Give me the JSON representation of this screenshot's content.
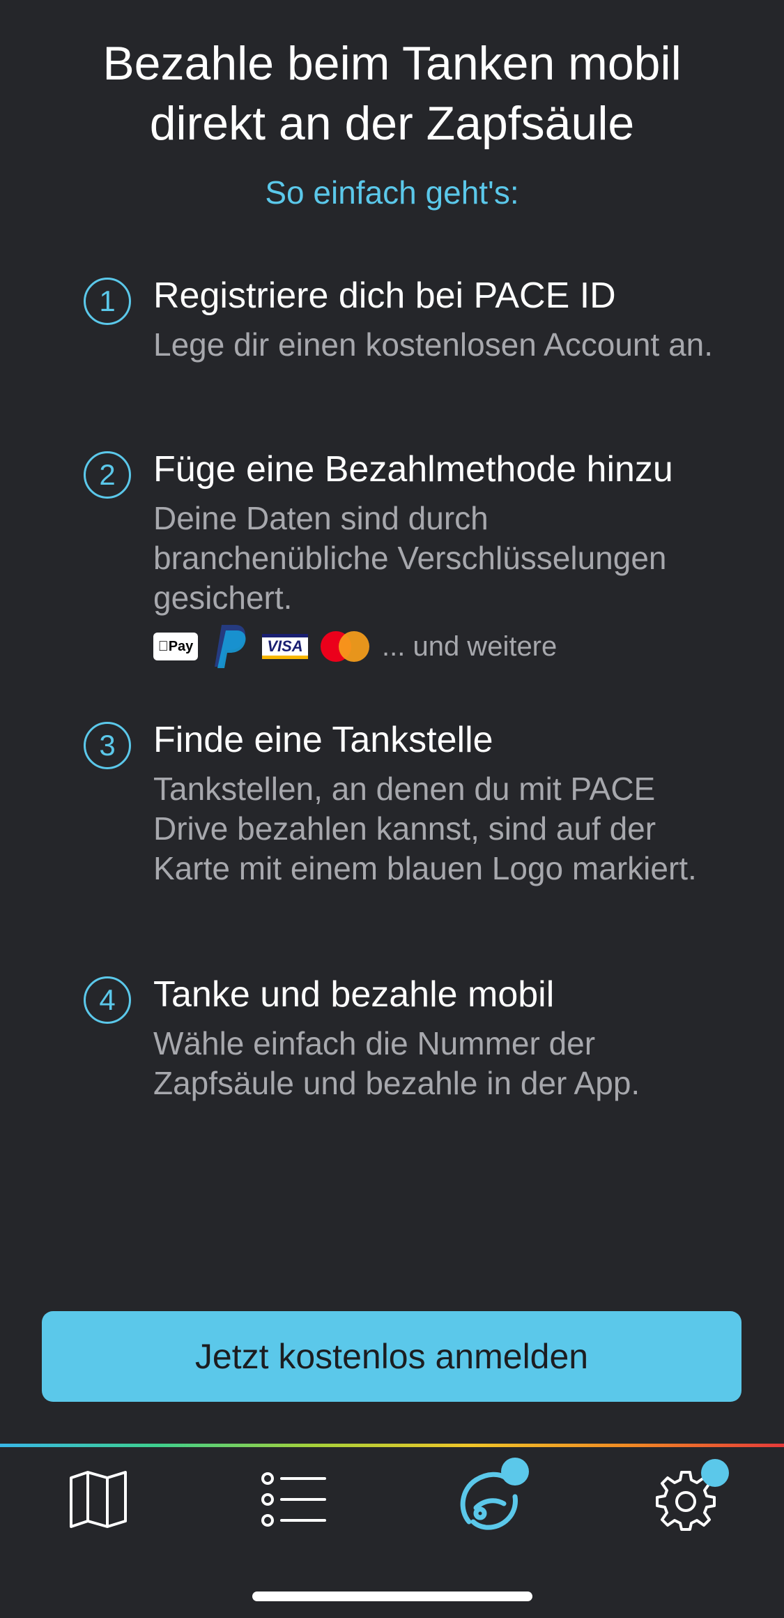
{
  "header": {
    "title_line1": "Bezahle beim Tanken mobil",
    "title_line2": "direkt an der Zapfsäule",
    "subtitle": "So einfach geht's:"
  },
  "steps": [
    {
      "number": "1",
      "title": "Registriere dich bei PACE ID",
      "description": "Lege dir einen kostenlosen Account an."
    },
    {
      "number": "2",
      "title": "Füge eine Bezahlmethode hinzu",
      "description": "Deine Daten sind durch branchenübliche Verschlüsselungen gesichert.",
      "payment_methods": [
        "apple-pay",
        "paypal",
        "visa",
        "mastercard"
      ],
      "apple_pay_label": "Pay",
      "visa_label": "VISA",
      "more_label": "... und weitere"
    },
    {
      "number": "3",
      "title": "Finde eine Tankstelle",
      "description": "Tankstellen, an denen du mit PACE Drive bezahlen kannst, sind auf der Karte mit einem blauen Logo markiert."
    },
    {
      "number": "4",
      "title": "Tanke und bezahle mobil",
      "description": "Wähle einfach die Nummer der Zapfsäule und bezahle in der App."
    }
  ],
  "cta": {
    "label": "Jetzt kostenlos anmelden"
  },
  "tabbar": {
    "items": [
      {
        "icon": "map-icon",
        "active": false,
        "badge": false
      },
      {
        "icon": "list-icon",
        "active": false,
        "badge": false
      },
      {
        "icon": "pace-drive-icon",
        "active": true,
        "badge": true
      },
      {
        "icon": "gear-icon",
        "active": false,
        "badge": true
      }
    ]
  },
  "colors": {
    "background": "#25262a",
    "accent": "#5bc8ea",
    "text_primary": "#ffffff",
    "text_secondary": "#a7a8ad"
  }
}
